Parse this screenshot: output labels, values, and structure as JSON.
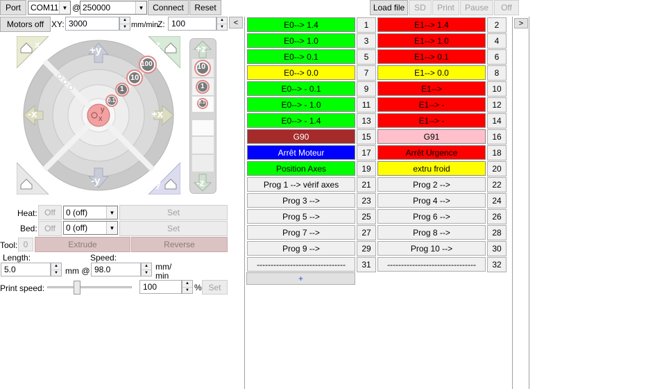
{
  "toolbar": {
    "port_label": "Port",
    "port_value": "COM11",
    "at_label": "@",
    "baud_value": "250000",
    "connect_label": "Connect",
    "reset_label": "Reset",
    "load_file_label": "Load file",
    "sd_label": "SD",
    "print_label": "Print",
    "pause_label": "Pause",
    "off_label": "Off"
  },
  "motion": {
    "motors_off_label": "Motors off",
    "xy_label": "XY:",
    "xy_value": "3000",
    "xy_unit": "mm/min",
    "z_label": "Z:",
    "z_value": "100",
    "collapse_label": "<"
  },
  "jog": {
    "plus_y": "+y",
    "minus_y": "-y",
    "plus_x": "+x",
    "minus_x": "-x",
    "home_x": "x",
    "home_y": "y",
    "home_z": "z",
    "step_100": "100",
    "step_10": "10",
    "step_1": "1",
    "step_01": "0.1",
    "center_y": "y",
    "center_x": "x",
    "plus_z": "+z",
    "minus_z": "-z",
    "z_10": "10",
    "z_1": "1",
    "z_01": "0.1"
  },
  "temp": {
    "heat_label": "Heat:",
    "heat_off": "Off",
    "heat_value": "0 (off)",
    "heat_set": "Set",
    "bed_label": "Bed:",
    "bed_off": "Off",
    "bed_value": "0 (off)",
    "bed_set": "Set"
  },
  "extrude": {
    "tool_label": "Tool:",
    "tool_value": "0",
    "extrude_label": "Extrude",
    "reverse_label": "Reverse",
    "length_label": "Length:",
    "length_value": "5.0",
    "mm_at": "mm @",
    "speed_label": "Speed:",
    "speed_value": "98.0",
    "speed_unit_1": "mm/",
    "speed_unit_2": "min",
    "print_speed_label": "Print speed:",
    "print_speed_value": "100",
    "percent": "%",
    "print_speed_set": "Set",
    "print_speed_slider": 0.35
  },
  "macros": {
    "rows": [
      {
        "l": "E0--> 1.4",
        "lc": "#00ff00",
        "ln": "1",
        "r": "E1--> 1.4",
        "rc": "#ff0000",
        "rn": "2"
      },
      {
        "l": "E0--> 1.0",
        "lc": "#00ff00",
        "ln": "3",
        "r": "E1--> 1.0",
        "rc": "#ff0000",
        "rn": "4"
      },
      {
        "l": "E0--> 0.1",
        "lc": "#00ff00",
        "ln": "5",
        "r": "E1--> 0.1",
        "rc": "#ff0000",
        "rn": "6"
      },
      {
        "l": "E0--> 0.0",
        "lc": "#ffff00",
        "ln": "7",
        "r": "E1--> 0.0",
        "rc": "#ffff00",
        "rn": "8"
      },
      {
        "l": "E0--> - 0.1",
        "lc": "#00ff00",
        "ln": "9",
        "r": "E1-->",
        "rc": "#ff0000",
        "rn": "10"
      },
      {
        "l": "E0--> - 1.0",
        "lc": "#00ff00",
        "ln": "11",
        "r": "E1--> -",
        "rc": "#ff0000",
        "rn": "12"
      },
      {
        "l": "E0--> - 1.4",
        "lc": "#00ff00",
        "ln": "13",
        "r": "E1--> -",
        "rc": "#ff0000",
        "rn": "14"
      },
      {
        "l": "G90",
        "lc": "#a52a2a",
        "ln": "15",
        "r": "G91",
        "rc": "#ffc0cb",
        "rn": "16"
      },
      {
        "l": "Arrêt Moteur",
        "lc": "#0000ff",
        "ln": "17",
        "r": "Arrêt Urgence",
        "rc": "#ff0000",
        "rn": "18"
      },
      {
        "l": "Position Axes",
        "lc": "#00ff00",
        "ln": "19",
        "r": "extru froid",
        "rc": "#ffff00",
        "rn": "20"
      },
      {
        "l": "Prog 1 --> vérif axes",
        "lc": "#f0f0f0",
        "ln": "21",
        "r": "Prog 2 -->",
        "rc": "#f0f0f0",
        "rn": "22"
      },
      {
        "l": "Prog 3 -->",
        "lc": "#f0f0f0",
        "ln": "23",
        "r": "Prog 4 -->",
        "rc": "#f0f0f0",
        "rn": "24"
      },
      {
        "l": "Prog 5 -->",
        "lc": "#f0f0f0",
        "ln": "25",
        "r": "Prog 6 -->",
        "rc": "#f0f0f0",
        "rn": "26"
      },
      {
        "l": "Prog 7 -->",
        "lc": "#f0f0f0",
        "ln": "27",
        "r": "Prog 8 -->",
        "rc": "#f0f0f0",
        "rn": "28"
      },
      {
        "l": "Prog 9 -->",
        "lc": "#f0f0f0",
        "ln": "29",
        "r": "Prog 10 -->",
        "rc": "#f0f0f0",
        "rn": "30"
      },
      {
        "l": "--------------------------------",
        "lc": "#f0f0f0",
        "ln": "31",
        "r": "--------------------------------",
        "rc": "#f0f0f0",
        "rn": "32"
      }
    ],
    "add_label": "+"
  },
  "right_panel": {
    "expand_label": ">"
  }
}
